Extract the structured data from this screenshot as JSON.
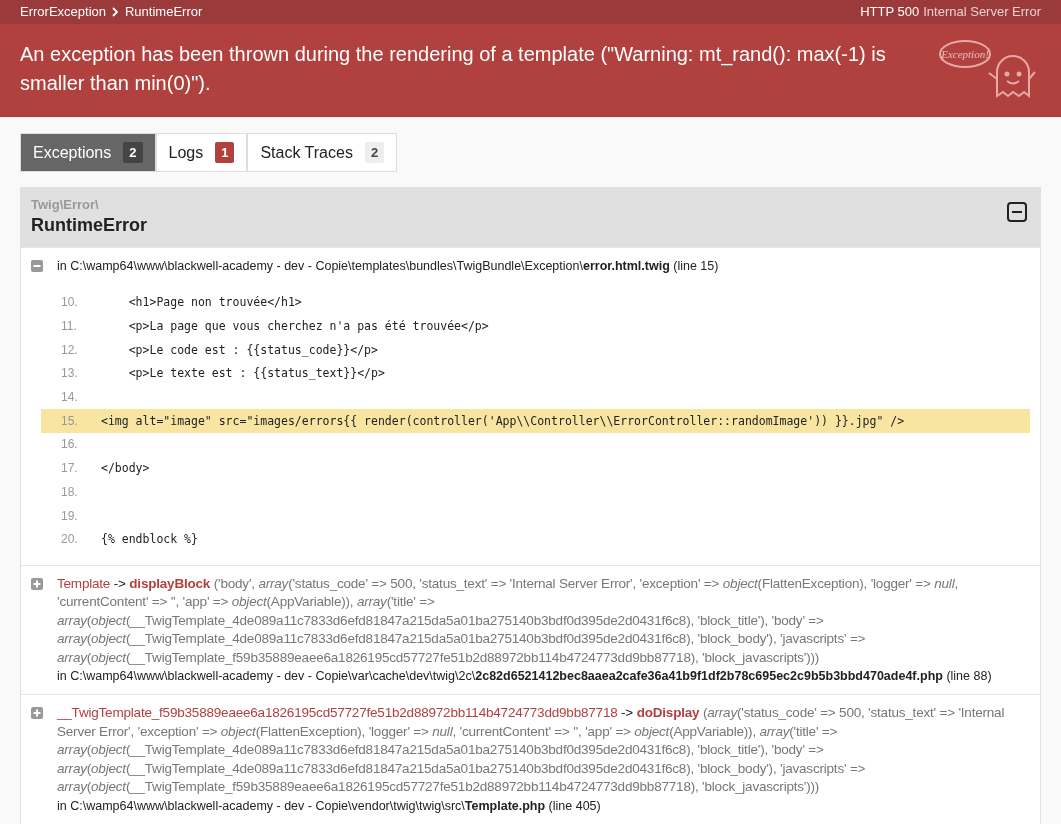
{
  "breadcrumbs": [
    "ErrorException",
    "RuntimeError"
  ],
  "status": {
    "code": "HTTP 500",
    "text": "Internal Server Error"
  },
  "message": "An exception has been thrown during the rendering of a template (\"Warning: mt_rand(): max(-1) is smaller than min(0)\").",
  "logo_text": "Exception!",
  "tabs": [
    {
      "label": "Exceptions",
      "count": "2",
      "selected": true,
      "color": "#444444"
    },
    {
      "label": "Logs",
      "count": "1",
      "selected": false,
      "color": "#b0413e"
    },
    {
      "label": "Stack Traces",
      "count": "2",
      "selected": false,
      "color": "#eeeeee"
    }
  ],
  "exception": {
    "namespace": "Twig\\Error\\",
    "class": "RuntimeError",
    "expanded": true
  },
  "traces": [
    {
      "expanded": true,
      "location": "in C:\\wamp64\\www\\blackwell-academy - dev - Copie\\templates\\bundles\\TwigBundle\\Exception\\**error.html.twig** (line 15)",
      "code": [
        {
          "number": "10.",
          "code": "    <h1>Page non trouvée</h1>",
          "highlighted": false
        },
        {
          "number": "11.",
          "code": "    <p>La page que vous cherchez n'a pas été trouvée</p>",
          "highlighted": false
        },
        {
          "number": "12.",
          "code": "    <p>Le code est : {{status_code}}</p>",
          "highlighted": false
        },
        {
          "number": "13.",
          "code": "    <p>Le texte est : {{status_text}}</p>",
          "highlighted": false
        },
        {
          "number": "14.",
          "highlighted": false
        },
        {
          "number": "15.",
          "code": "<img alt=\"image\" src=\"images/errors{{ render(controller('App\\\\Controller\\\\ErrorController::randomImage')) }}.jpg\" />",
          "highlighted": true
        },
        {
          "number": "16.",
          "highlighted": false
        },
        {
          "number": "17.",
          "code": "</body>",
          "highlighted": false
        },
        {
          "number": "18.",
          "highlighted": false
        },
        {
          "number": "19.",
          "highlighted": false
        },
        {
          "number": "20.",
          "code": "{% endblock %}",
          "highlighted": false
        }
      ]
    },
    {
      "expanded": false,
      "class": "Template",
      "arrow": "->",
      "method": "displayBlock",
      "args": "('body', *array*('status_code' => 500, 'status_text' => 'Internal Server Error', 'exception' => *object*(FlattenException), 'logger' => *null*, 'currentContent' => '', 'app' => *object*(AppVariable)), *array*('title' => *array*(*object*(__TwigTemplate_4de089a11c7833d6efd81847a215da5a01ba275140b3bdf0d395de2d0431f6c8), 'block_title'), 'body' => *array*(*object*(__TwigTemplate_4de089a11c7833d6efd81847a215da5a01ba275140b3bdf0d395de2d0431f6c8), 'block_body'), 'javascripts' => *array*(*object*(__TwigTemplate_f59b35889eaee6a1826195cd57727fe51b2d88972bb114b4724773dd9bb87718), 'block_javascripts')))",
      "location": "in C:\\wamp64\\www\\blackwell-academy - dev - Copie\\var\\cache\\dev\\twig\\2c\\**2c82d6521412bec8aaea2cafe36a41b9f1df2b78c695ec2c9b5b3bbd470ade4f.php** (line 88)"
    },
    {
      "expanded": false,
      "class": "__TwigTemplate_f59b35889eaee6a1826195cd57727fe51b2d88972bb114b4724773dd9bb87718",
      "arrow": "->",
      "method": "doDisplay",
      "args": "(*array*('status_code' => 500, 'status_text' => 'Internal Server Error', 'exception' => *object*(FlattenException), 'logger' => *null*, 'currentContent' => '', 'app' => *object*(AppVariable)), *array*('title' => *array*(*object*(__TwigTemplate_4de089a11c7833d6efd81847a215da5a01ba275140b3bdf0d395de2d0431f6c8), 'block_title'), 'body' => *array*(*object*(__TwigTemplate_4de089a11c7833d6efd81847a215da5a01ba275140b3bdf0d395de2d0431f6c8), 'block_body'), 'javascripts' => *array*(*object*(__TwigTemplate_f59b35889eaee6a1826195cd57727fe51b2d88972bb114b4724773dd9bb87718), 'block_javascripts')))",
      "location": "in C:\\wamp64\\www\\blackwell-academy - dev - Copie\\vendor\\twig\\twig\\src\\**Template.php** (line 405)"
    }
  ]
}
